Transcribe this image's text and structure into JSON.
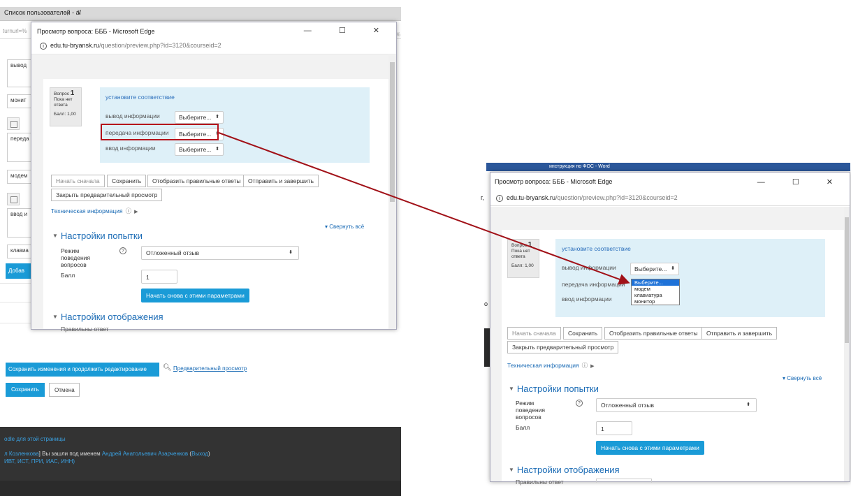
{
  "bg_browser": {
    "tab_title": "Список пользователей - al",
    "tab_plus": "+",
    "tab_chevron": "∨",
    "url_fragment": "turnurl=%",
    "edge_fragment": "%",
    "edge_fragment2": "ва",
    "inputs": [
      "вывод",
      "монит",
      "переда",
      "модем",
      "ввод и",
      "клавиа"
    ],
    "add_button": "Добав",
    "save_continue_button": "Сохранить изменения и продолжить редактирование",
    "preview_link": "Предварительный просмотр",
    "save_button": "Сохранить",
    "cancel_button": "Отмена",
    "footer": {
      "line1": "odle для этой страницы",
      "line2_link1": "л Козленкова",
      "line2_text": "] Вы зашли под именем ",
      "line2_link2": "Андрей Анатольевич Азарченков",
      "line2_logout_open": " (",
      "line2_logout": "Выход",
      "line2_logout_close": ")",
      "line3": "ИВТ, ИСТ, ПРИ, ИАС, ИНН)"
    }
  },
  "left_window": {
    "title": "Просмотр вопроса: БББ - Microsoft Edge",
    "controls": "—  ☐  ✕",
    "url_host": "edu.tu-bryansk.ru",
    "url_path": "/question/preview.php?id=3120&courseid=2"
  },
  "right_window": {
    "word_title": "инструкция по ФОС - Word",
    "title": "Просмотр вопроса: БББ - Microsoft Edge",
    "controls": "—  ☐  ✕",
    "url_host": "edu.tu-bryansk.ru",
    "url_path": "/question/preview.php?id=3120&courseid=2",
    "left_edge": "г,",
    "left_edge2": "о"
  },
  "question": {
    "number_label": "Вопрос",
    "number": "1",
    "status": "Пока нет ответа",
    "score": "Балл: 1,00",
    "prompt": "установите соответствие",
    "rows": [
      {
        "label": "вывод информации",
        "select": "Выберите..."
      },
      {
        "label": "передача информации",
        "select": "Выберите..."
      },
      {
        "label": "ввод информации",
        "select": "Выберите..."
      }
    ],
    "dropdown_options": [
      "Выберите...",
      "модем",
      "клавиатура",
      "монитор"
    ]
  },
  "buttons": {
    "restart": "Начать сначала",
    "save": "Сохранить",
    "show_correct": "Отобразить правильные ответы",
    "submit": "Отправить и завершить",
    "close_preview": "Закрыть предварительный просмотр"
  },
  "tech_info": "Техническая информация",
  "collapse_all": "▾ Свернуть всё",
  "attempt_settings": {
    "heading": "Настройки попытки",
    "behaviour_label": "Режим поведения вопросов",
    "behaviour_value": "Отложенный отзыв",
    "mark_label": "Балл",
    "mark_value": "1",
    "restart_button": "Начать снова с этими параметрами"
  },
  "display_settings": {
    "heading": "Настройки отображения",
    "next_label": "Правильны ответ"
  },
  "colors": {
    "accent": "#1a9bd7",
    "link": "#1a6bb5",
    "highlight_box": "#b5121b",
    "arrow": "#a11118",
    "question_bg": "#def0f8",
    "dropdown_selected": "#1e72d8"
  }
}
